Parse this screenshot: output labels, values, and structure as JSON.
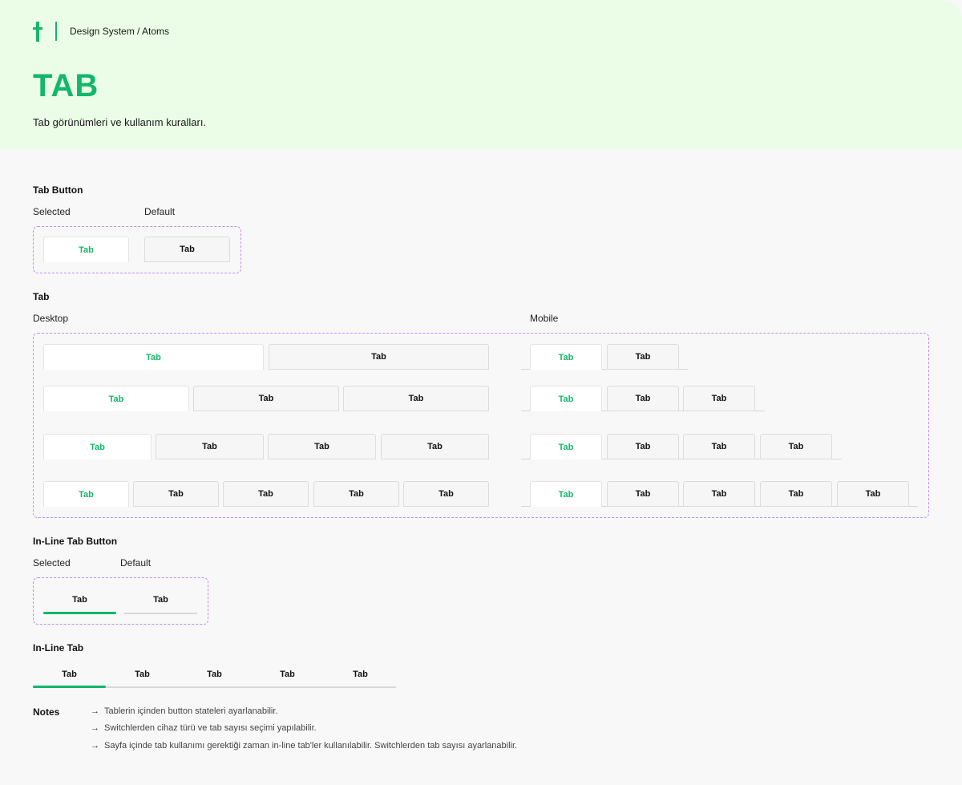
{
  "header": {
    "breadcrumb": "Design System / Atoms",
    "title": "TAB",
    "subtitle": "Tab görünümleri ve kullanım kuralları."
  },
  "colors": {
    "accent": "#12b76a",
    "header_bg": "#ebfde7",
    "dashed": "#c48cf5"
  },
  "tab_button": {
    "title": "Tab Button",
    "selected_label": "Selected",
    "default_label": "Default",
    "tab_text": "Tab"
  },
  "tab": {
    "title": "Tab",
    "desktop_label": "Desktop",
    "mobile_label": "Mobile",
    "tab_text": "Tab"
  },
  "inline_tab_button": {
    "title": "In-Line Tab Button",
    "selected_label": "Selected",
    "default_label": "Default",
    "tab_text": "Tab"
  },
  "inline_tab": {
    "title": "In-Line Tab",
    "tabs": [
      "Tab",
      "Tab",
      "Tab",
      "Tab",
      "Tab"
    ]
  },
  "notes": {
    "title": "Notes",
    "arrow": "→",
    "items": [
      "Tablerin içinden button stateleri ayarlanabilir.",
      "Switchlerden cihaz türü ve tab sayısı seçimi yapılabilir.",
      "Sayfa içinde tab kullanımı gerektiği zaman in-line tab'ler kullanılabilir. Switchlerden tab sayısı ayarlanabilir."
    ]
  }
}
